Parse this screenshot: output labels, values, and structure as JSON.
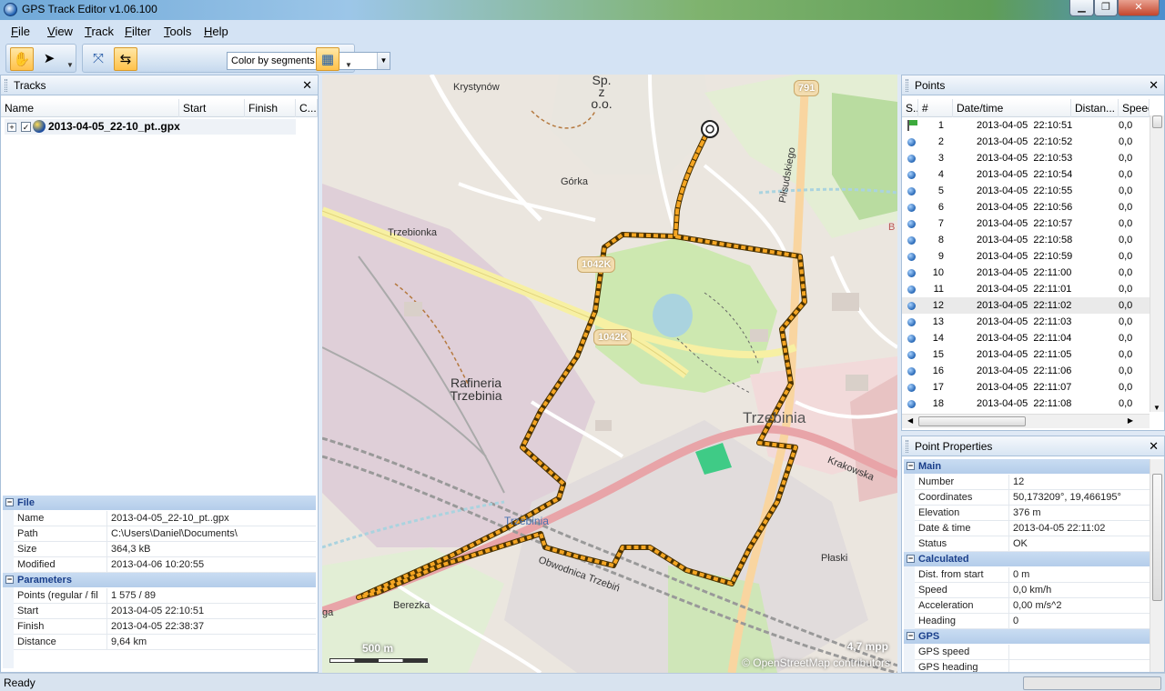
{
  "window": {
    "title": "GPS Track Editor v1.06.100"
  },
  "menu": [
    {
      "label": "File",
      "u": "F",
      "rest": "ile"
    },
    {
      "label": "View",
      "u": "V",
      "rest": "iew"
    },
    {
      "label": "Track",
      "u": "T",
      "rest": "rack"
    },
    {
      "label": "Filter",
      "u": "F",
      "rest": "ilter"
    },
    {
      "label": "Tools",
      "u": "T",
      "rest": "ools"
    },
    {
      "label": "Help",
      "u": "H",
      "rest": "elp"
    }
  ],
  "toolbar": {
    "color_mode": "Color by segments"
  },
  "tracks_panel": {
    "title": "Tracks",
    "columns": [
      "Name",
      "Start",
      "Finish",
      "C..."
    ],
    "rows": [
      {
        "name": "2013-04-05_22-10_pt..gpx",
        "checked": true
      }
    ]
  },
  "file_props": {
    "section_file": "File",
    "file_rows": [
      {
        "key": "Name",
        "value": "2013-04-05_22-10_pt..gpx"
      },
      {
        "key": "Path",
        "value": "C:\\Users\\Daniel\\Documents\\"
      },
      {
        "key": "Size",
        "value": "364,3 kB"
      },
      {
        "key": "Modified",
        "value": "2013-04-06 10:20:55"
      }
    ],
    "section_params": "Parameters",
    "param_rows": [
      {
        "key": "Points (regular / fil",
        "value": "1 575 / 89"
      },
      {
        "key": "Start",
        "value": "2013-04-05 22:10:51"
      },
      {
        "key": "Finish",
        "value": "2013-04-05 22:38:37"
      },
      {
        "key": "Distance",
        "value": "9,64 km"
      }
    ]
  },
  "map": {
    "labels": {
      "krystynow": "Krystynów",
      "spzoo": "Sp. z o.o.",
      "gorka": "Górka",
      "trzebionka": "Trzebionka",
      "pilsudskiego": "Piłsudskiego",
      "rafineria": "Rafineria Trzebinia",
      "trzebinia_city": "Trzebinia",
      "trzebinia_small": "Trzebinia",
      "krakowska": "Krakowska",
      "obwodnica": "Obwodnica Trzebiń",
      "berezka": "Berezka",
      "plaski": "Płaski",
      "ga": "ga",
      "b": "B"
    },
    "shields": {
      "s791": "791",
      "s1042a": "1042K",
      "s1042b": "1042K"
    },
    "scale": "500 m",
    "mpp": "4,7 mpp",
    "attribution": "© OpenStreetMap contributors"
  },
  "points_panel": {
    "title": "Points",
    "columns": [
      "S..",
      "#",
      "Date/time",
      "Distan...",
      "Speed"
    ],
    "rows": [
      {
        "num": "1",
        "dt": "2013-04-05  22:10:51",
        "dist": "0,0",
        "first": true
      },
      {
        "num": "2",
        "dt": "2013-04-05  22:10:52",
        "dist": "0,0"
      },
      {
        "num": "3",
        "dt": "2013-04-05  22:10:53",
        "dist": "0,0"
      },
      {
        "num": "4",
        "dt": "2013-04-05  22:10:54",
        "dist": "0,0"
      },
      {
        "num": "5",
        "dt": "2013-04-05  22:10:55",
        "dist": "0,0"
      },
      {
        "num": "6",
        "dt": "2013-04-05  22:10:56",
        "dist": "0,0"
      },
      {
        "num": "7",
        "dt": "2013-04-05  22:10:57",
        "dist": "0,0"
      },
      {
        "num": "8",
        "dt": "2013-04-05  22:10:58",
        "dist": "0,0"
      },
      {
        "num": "9",
        "dt": "2013-04-05  22:10:59",
        "dist": "0,0"
      },
      {
        "num": "10",
        "dt": "2013-04-05  22:11:00",
        "dist": "0,0"
      },
      {
        "num": "11",
        "dt": "2013-04-05  22:11:01",
        "dist": "0,0"
      },
      {
        "num": "12",
        "dt": "2013-04-05  22:11:02",
        "dist": "0,0",
        "selected": true
      },
      {
        "num": "13",
        "dt": "2013-04-05  22:11:03",
        "dist": "0,0"
      },
      {
        "num": "14",
        "dt": "2013-04-05  22:11:04",
        "dist": "0,0"
      },
      {
        "num": "15",
        "dt": "2013-04-05  22:11:05",
        "dist": "0,0"
      },
      {
        "num": "16",
        "dt": "2013-04-05  22:11:06",
        "dist": "0,0"
      },
      {
        "num": "17",
        "dt": "2013-04-05  22:11:07",
        "dist": "0,0"
      },
      {
        "num": "18",
        "dt": "2013-04-05  22:11:08",
        "dist": "0,0"
      }
    ]
  },
  "point_props": {
    "title": "Point Properties",
    "section_main": "Main",
    "main_rows": [
      {
        "key": "Number",
        "value": "12"
      },
      {
        "key": "Coordinates",
        "value": "50,173209°, 19,466195°"
      },
      {
        "key": "Elevation",
        "value": "376 m"
      },
      {
        "key": "Date & time",
        "value": "2013-04-05 22:11:02"
      },
      {
        "key": "Status",
        "value": "OK"
      }
    ],
    "section_calc": "Calculated",
    "calc_rows": [
      {
        "key": "Dist. from start",
        "value": "0 m"
      },
      {
        "key": "Speed",
        "value": "0,0 km/h"
      },
      {
        "key": "Acceleration",
        "value": "0,00 m/s^2"
      },
      {
        "key": "Heading",
        "value": "0"
      }
    ],
    "section_gps": "GPS",
    "gps_rows": [
      {
        "key": "GPS speed",
        "value": ""
      },
      {
        "key": "GPS heading",
        "value": ""
      }
    ]
  },
  "status": {
    "text": "Ready"
  }
}
